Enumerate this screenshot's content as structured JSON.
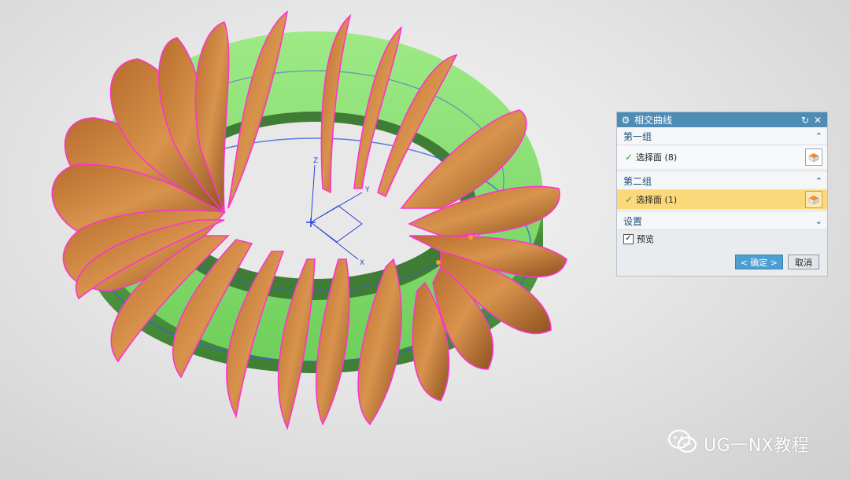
{
  "dialog": {
    "title": "相交曲线",
    "group1": {
      "label": "第一组",
      "select_label": "选择面 (8)"
    },
    "group2": {
      "label": "第二组",
      "select_label": "选择面 (1)"
    },
    "settings": {
      "label": "设置"
    },
    "preview": {
      "label": "预览",
      "checked": true
    },
    "ok_label": "< 确定 >",
    "cancel_label": "取消"
  },
  "viewport": {
    "axes": {
      "x": "X",
      "y": "Y",
      "z": "Z"
    },
    "colors": {
      "torus": "#7fd66b",
      "fins": "#c9803e",
      "highlight": "#ff33cc",
      "curve": "#3050d8"
    }
  },
  "watermark": {
    "text": "UG一NX教程",
    "icon": "wechat-icon"
  },
  "icons": [
    "gear-icon",
    "reset-icon",
    "close-icon",
    "chevron-up-icon",
    "chevron-down-icon",
    "checkmark-icon",
    "face-select-icon"
  ]
}
